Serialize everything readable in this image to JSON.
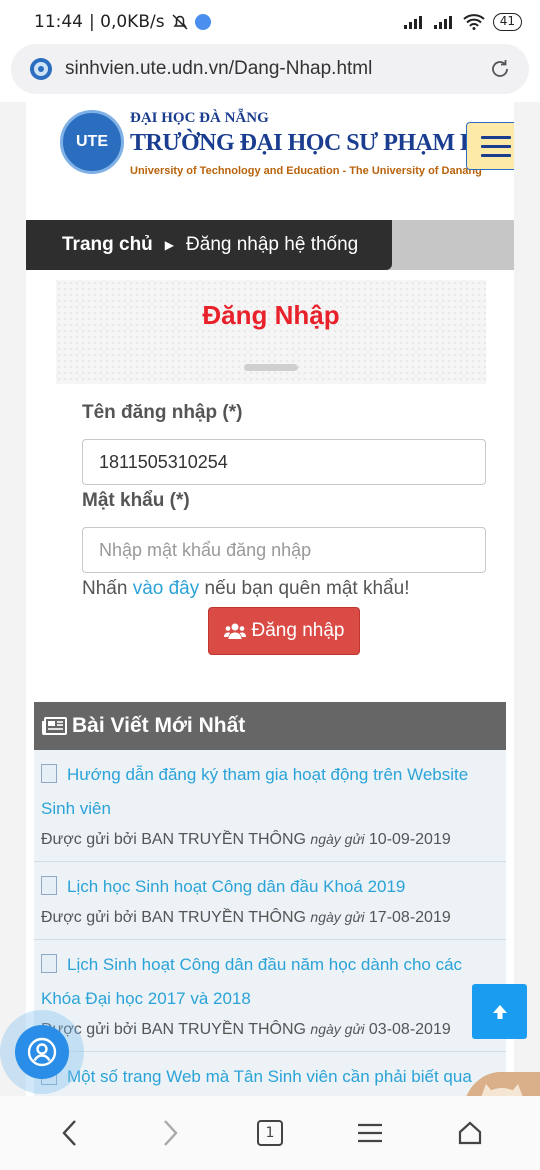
{
  "status_bar": {
    "time": "11:44",
    "network_speed": "| 0,0KB/s",
    "battery": "41"
  },
  "browser": {
    "url": "sinhvien.ute.udn.vn/Dang-Nhap.html"
  },
  "header": {
    "logo_text": "UTE",
    "line1": "ĐẠI HỌC ĐÀ NẴNG",
    "line2": "TRƯỜNG ĐẠI HỌC SƯ PHẠM KỸ THUẬT",
    "line3": "University of Technology and Education - The University of Danang"
  },
  "breadcrumb": {
    "home": "Trang chủ",
    "current": "Đăng nhập hệ thống"
  },
  "login": {
    "title": "Đăng Nhập",
    "username_label": "Tên đăng nhập (*)",
    "username_value": "1811505310254",
    "password_label": "Mật khẩu (*)",
    "password_placeholder": "Nhập mật khẩu đăng nhập",
    "forgot_prefix": "Nhấn",
    "forgot_link": "vào đây",
    "forgot_suffix": "nếu bạn quên mật khẩu!",
    "button_label": "Đăng nhập"
  },
  "news": {
    "header": "Bài Viết Mới Nhất",
    "items": [
      {
        "title": "Hướng dẫn đăng ký tham gia hoạt động trên Website Sinh viên",
        "meta_prefix": "Được gửi bởi BAN TRUYỀN THÔNG",
        "meta_date_label": "ngày gửi",
        "date": "10-09-2019"
      },
      {
        "title": "Lịch học Sinh hoạt Công dân đầu Khoá 2019",
        "meta_prefix": "Được gửi bởi BAN TRUYỀN THÔNG",
        "meta_date_label": "ngày gửi",
        "date": "17-08-2019"
      },
      {
        "title": "Lịch Sinh hoạt Công dân đầu năm học dành cho các Khóa Đại học 2017 và 2018",
        "meta_prefix": "Được gửi bởi BAN TRUYỀN THÔNG",
        "meta_date_label": "ngày gửi",
        "date": "03-08-2019"
      },
      {
        "title": "Một số trang Web mà Tân Sinh viên cần phải biết qua",
        "meta_prefix": "",
        "meta_date_label": "",
        "date": ""
      }
    ]
  },
  "bottom_nav": {
    "tab_count": "1"
  },
  "colors": {
    "accent_red": "#db4b46",
    "link_blue": "#2ba3d8",
    "title_red": "#e8212a"
  }
}
